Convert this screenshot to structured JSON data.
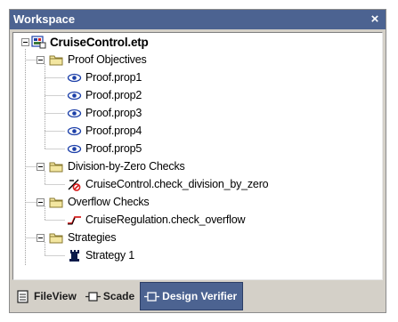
{
  "window": {
    "title": "Workspace",
    "close_glyph": "×"
  },
  "tree": {
    "root": {
      "label": "CruiseControl.etp",
      "icon": "project-icon"
    },
    "groups": [
      {
        "label": "Proof Objectives",
        "icon": "folder-icon",
        "items": [
          {
            "label": "Proof.prop1",
            "icon": "eye-icon"
          },
          {
            "label": "Proof.prop2",
            "icon": "eye-icon"
          },
          {
            "label": "Proof.prop3",
            "icon": "eye-icon"
          },
          {
            "label": "Proof.prop4",
            "icon": "eye-icon"
          },
          {
            "label": "Proof.prop5",
            "icon": "eye-icon"
          }
        ]
      },
      {
        "label": "Division-by-Zero Checks",
        "icon": "folder-icon",
        "items": [
          {
            "label": "CruiseControl.check_division_by_zero",
            "icon": "division-check-icon"
          }
        ]
      },
      {
        "label": "Overflow Checks",
        "icon": "folder-icon",
        "items": [
          {
            "label": "CruiseRegulation.check_overflow",
            "icon": "overflow-check-icon"
          }
        ]
      },
      {
        "label": "Strategies",
        "icon": "folder-icon",
        "items": [
          {
            "label": "Strategy 1",
            "icon": "strategy-icon"
          }
        ]
      }
    ]
  },
  "tabs": [
    {
      "label": "FileView",
      "icon": "fileview-icon",
      "active": false
    },
    {
      "label": "Scade",
      "icon": "scade-icon",
      "active": false
    },
    {
      "label": "Design Verifier",
      "icon": "design-verifier-icon",
      "active": true
    }
  ],
  "colors": {
    "titlebar": "#4c6391",
    "panel_bg": "#d4d0c8",
    "folder_fill": "#f3e6a0",
    "folder_stroke": "#8a7a30",
    "eye_blue": "#1c3fa8",
    "alert_red": "#d81e1e"
  }
}
